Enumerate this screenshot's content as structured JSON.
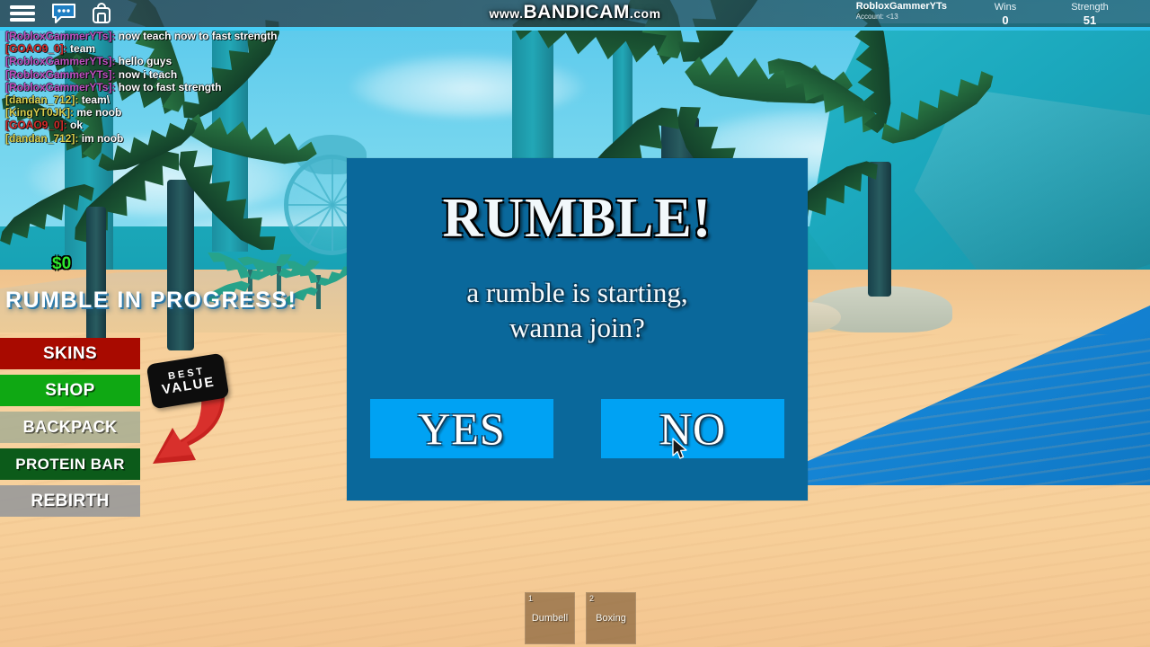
{
  "watermark": {
    "prefix": "www.",
    "brand": "BANDICAM",
    "suffix": ".com"
  },
  "topbar": {
    "icons": [
      {
        "name": "menu-icon",
        "label": "Menu"
      },
      {
        "name": "chat-icon",
        "label": "Chat"
      },
      {
        "name": "backpack-icon",
        "label": "Backpack"
      }
    ],
    "account": {
      "username": "RobloxGammerYTs",
      "account_age": "Account: <13"
    },
    "stats": [
      {
        "label": "Wins",
        "value": "0"
      },
      {
        "label": "Strength",
        "value": "51"
      }
    ]
  },
  "chat": {
    "messages": [
      {
        "user": "RobloxGammerYTs",
        "color": "#c050c0",
        "text": "now teach now to fast strength"
      },
      {
        "user": "GOAO9_0",
        "color": "#d62a2a",
        "text": "team"
      },
      {
        "user": "RobloxGammerYTs",
        "color": "#c050c0",
        "text": "hello guys"
      },
      {
        "user": "RobloxGammerYTs",
        "color": "#c050c0",
        "text": "now i teach"
      },
      {
        "user": "RobloxGammerYTs",
        "color": "#c050c0",
        "text": "how to fast strength"
      },
      {
        "user": "dandan_712",
        "color": "#d9cf4e",
        "text": "team\\"
      },
      {
        "user": "KingYT0JK",
        "color": "#d9cf4e",
        "text": "me noob"
      },
      {
        "user": "GOAO9_0",
        "color": "#d62a2a",
        "text": "ok"
      },
      {
        "user": "dandan_712",
        "color": "#d9cf4e",
        "text": "im noob"
      }
    ]
  },
  "hud": {
    "cash": "$0",
    "status": "RUMBLE IN PROGRESS!",
    "menu_buttons": [
      {
        "label": "SKINS",
        "color": "#a80a00"
      },
      {
        "label": "SHOP",
        "color": "#0fa813"
      },
      {
        "label": "BACKPACK",
        "color": "#a8ae93"
      },
      {
        "label": "PROTEIN BAR",
        "color": "#0c5b1a"
      },
      {
        "label": "REBIRTH",
        "color": "#9a9a9a"
      }
    ],
    "best_value_tag": {
      "line1": "BEST",
      "line2": "VALUE"
    }
  },
  "hotbar": {
    "slots": [
      {
        "number": "1",
        "name": "Dumbell"
      },
      {
        "number": "2",
        "name": "Boxing"
      }
    ]
  },
  "dialog": {
    "title": "RUMBLE!",
    "subtitle_line1": "a rumble is starting,",
    "subtitle_line2": "wanna join?",
    "yes_label": "YES",
    "no_label": "NO",
    "panel_color": "#0a689b",
    "button_color": "#00a2f3"
  }
}
